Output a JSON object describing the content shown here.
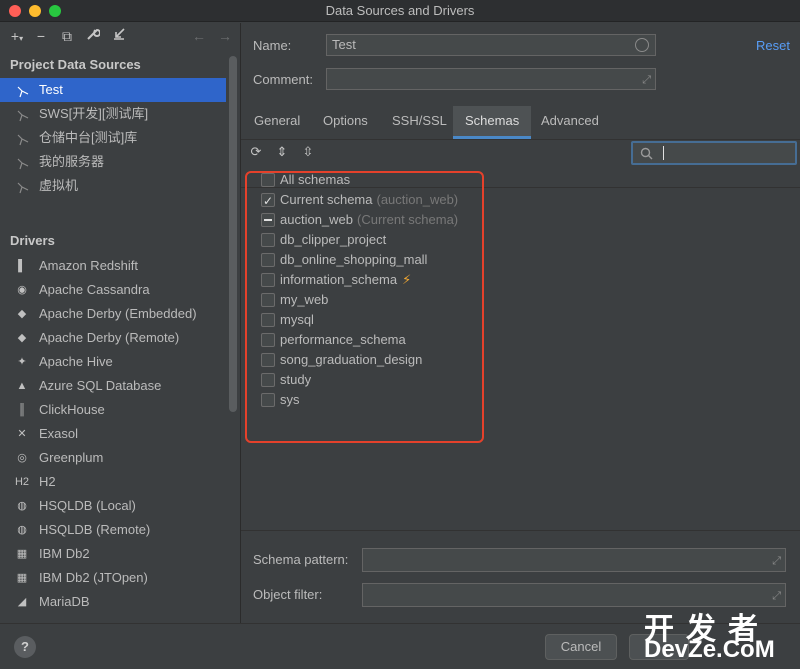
{
  "window": {
    "title": "Data Sources and Drivers"
  },
  "left": {
    "project_title": "Project Data Sources",
    "data_sources": [
      "Test",
      "SWS[开发][测试库]",
      "仓储中台[测试]库",
      "我的服务器",
      "虚拟机"
    ],
    "drivers_title": "Drivers",
    "drivers": [
      {
        "label": "Amazon Redshift",
        "icon": "▌"
      },
      {
        "label": "Apache Cassandra",
        "icon": "◉"
      },
      {
        "label": "Apache Derby (Embedded)",
        "icon": "◆"
      },
      {
        "label": "Apache Derby (Remote)",
        "icon": "◆"
      },
      {
        "label": "Apache Hive",
        "icon": "✦"
      },
      {
        "label": "Azure SQL Database",
        "icon": "▲"
      },
      {
        "label": "ClickHouse",
        "icon": "║"
      },
      {
        "label": "Exasol",
        "icon": "✕"
      },
      {
        "label": "Greenplum",
        "icon": "◎"
      },
      {
        "label": "H2",
        "icon": "H2"
      },
      {
        "label": "HSQLDB (Local)",
        "icon": "◍"
      },
      {
        "label": "HSQLDB (Remote)",
        "icon": "◍"
      },
      {
        "label": "IBM Db2",
        "icon": "▦"
      },
      {
        "label": "IBM Db2 (JTOpen)",
        "icon": "▦"
      },
      {
        "label": "MariaDB",
        "icon": "◢"
      }
    ]
  },
  "form": {
    "name_label": "Name:",
    "name_value": "Test",
    "comment_label": "Comment:",
    "comment_value": "",
    "reset_label": "Reset"
  },
  "tabs": [
    "General",
    "Options",
    "SSH/SSL",
    "Schemas",
    "Advanced"
  ],
  "active_tab": "Schemas",
  "schemas": [
    {
      "name": "All schemas",
      "hint": "",
      "state": "unchecked"
    },
    {
      "name": "Current schema",
      "hint": "(auction_web)",
      "state": "checked"
    },
    {
      "name": "auction_web",
      "hint": "(Current schema)",
      "state": "partial"
    },
    {
      "name": "db_clipper_project",
      "hint": "",
      "state": "unchecked"
    },
    {
      "name": "db_online_shopping_mall",
      "hint": "",
      "state": "unchecked"
    },
    {
      "name": "information_schema",
      "hint": "",
      "state": "unchecked",
      "badge": "lightning-icon"
    },
    {
      "name": "my_web",
      "hint": "",
      "state": "unchecked"
    },
    {
      "name": "mysql",
      "hint": "",
      "state": "unchecked"
    },
    {
      "name": "performance_schema",
      "hint": "",
      "state": "unchecked"
    },
    {
      "name": "song_graduation_design",
      "hint": "",
      "state": "unchecked"
    },
    {
      "name": "study",
      "hint": "",
      "state": "unchecked"
    },
    {
      "name": "sys",
      "hint": "",
      "state": "unchecked"
    }
  ],
  "bottom": {
    "schema_pattern_label": "Schema pattern:",
    "object_filter_label": "Object filter:"
  },
  "footer": {
    "help": "?",
    "cancel_label": "Cancel"
  },
  "watermark": {
    "top": "开发者",
    "bottom": "DevZe.CoM"
  },
  "colors": {
    "selection": "#2f65ca",
    "accent": "#589df6",
    "highlight": "#e5412b"
  }
}
